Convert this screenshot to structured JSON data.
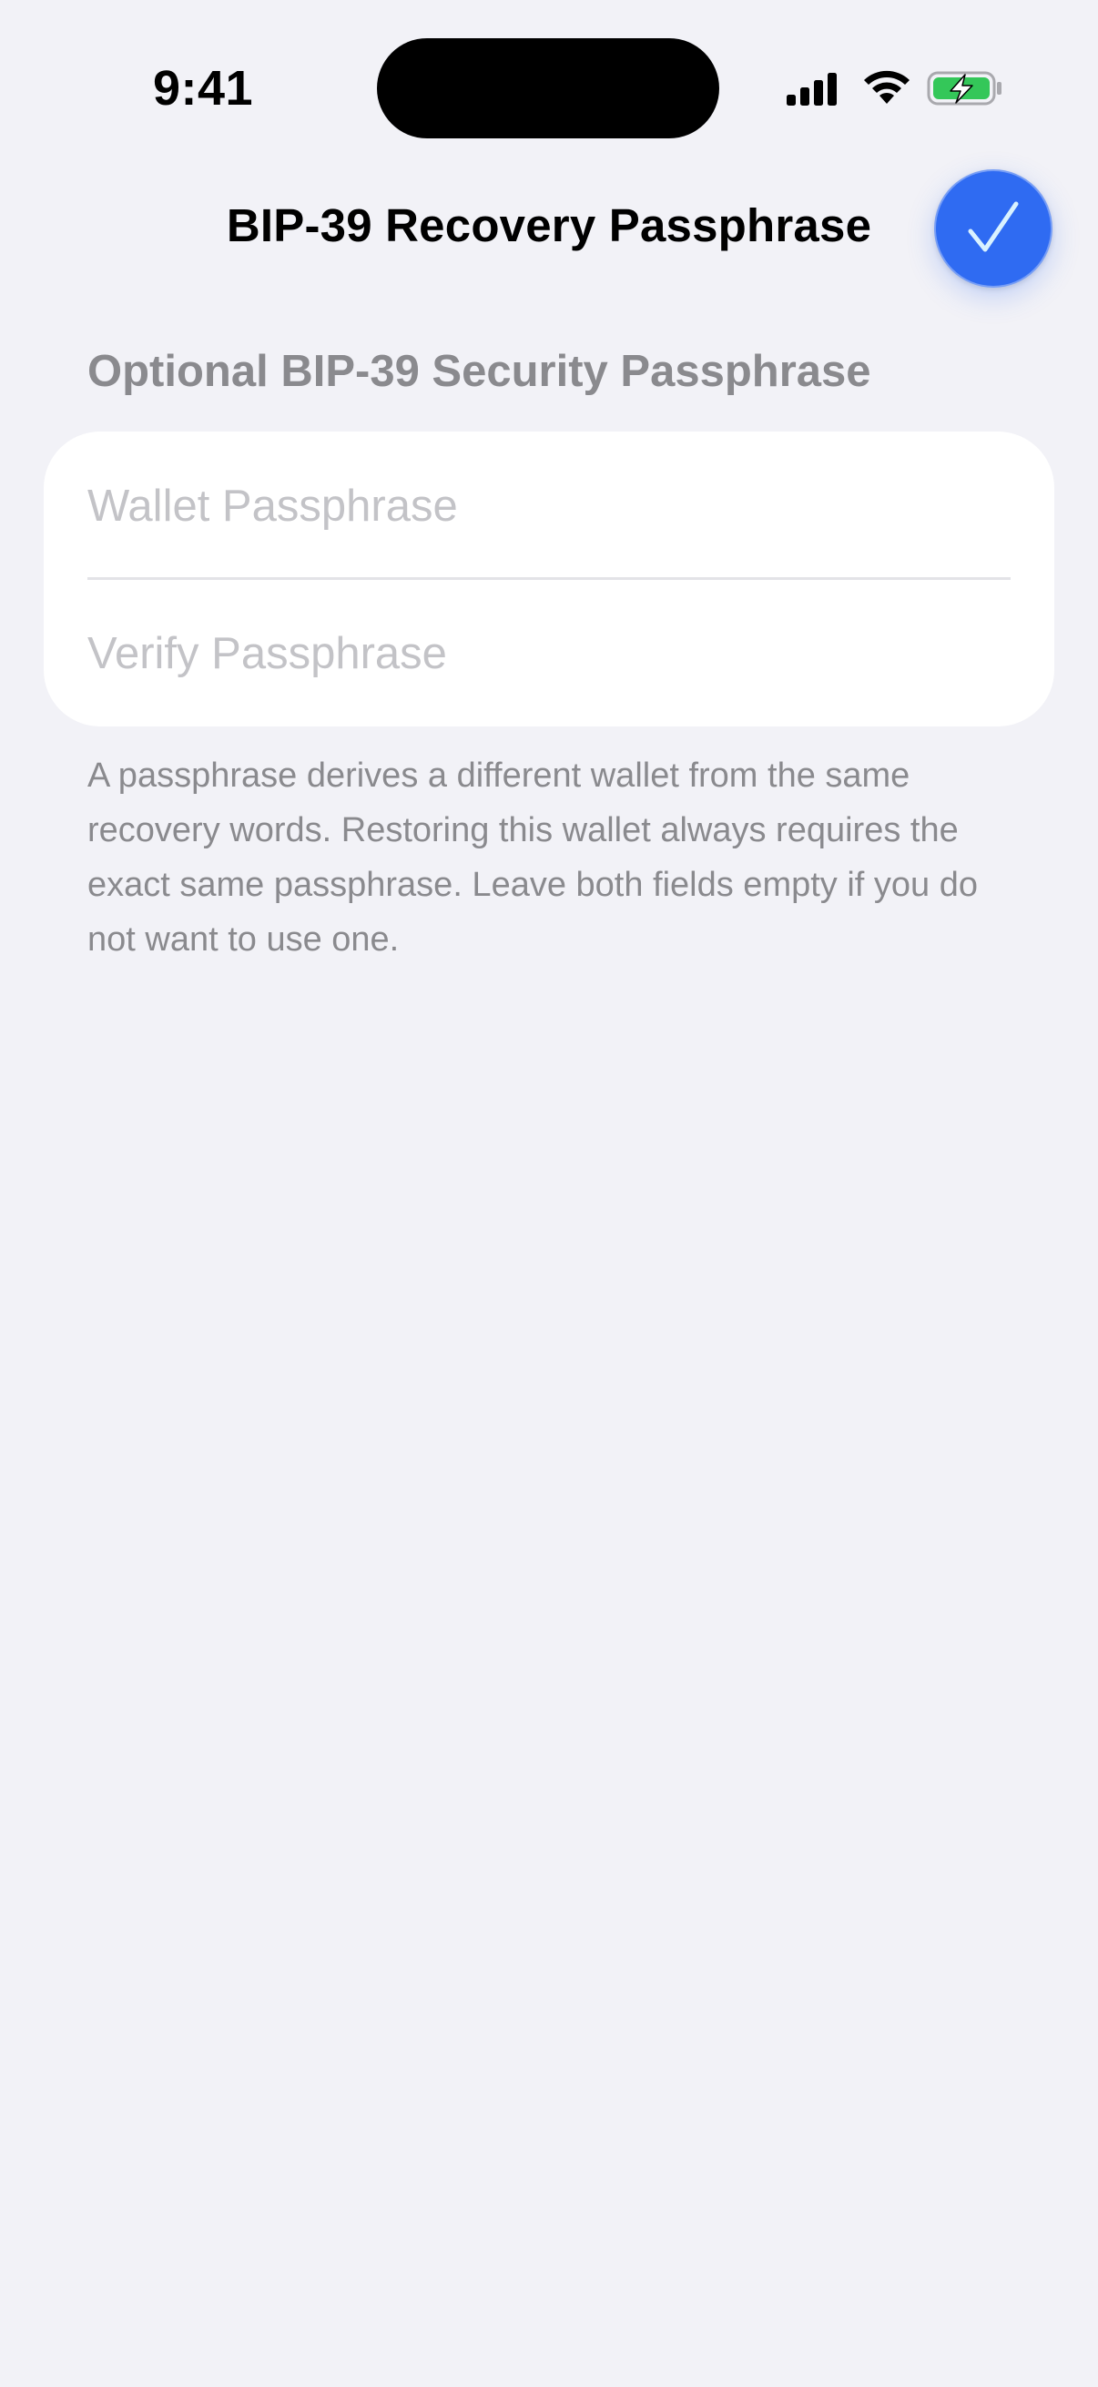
{
  "status_bar": {
    "time": "9:41",
    "icons": [
      "cellular-signal-icon",
      "wifi-icon",
      "battery-charging-icon"
    ]
  },
  "nav": {
    "title": "BIP-39 Recovery Passphrase",
    "done_button_icon": "checkmark-icon"
  },
  "section": {
    "header": "Optional BIP-39 Security Passphrase",
    "fields": [
      {
        "placeholder": "Wallet Passphrase",
        "value": ""
      },
      {
        "placeholder": "Verify Passphrase",
        "value": ""
      }
    ],
    "footer": "A passphrase derives a different wallet from the same recovery words. Restoring this wallet always requires the exact same passphrase. Leave both fields empty if you do not want to use one."
  },
  "colors": {
    "accent": "#2F6BF2",
    "background": "#F2F2F7",
    "secondary_text": "#8A8A8E",
    "battery_green": "#34C759"
  }
}
